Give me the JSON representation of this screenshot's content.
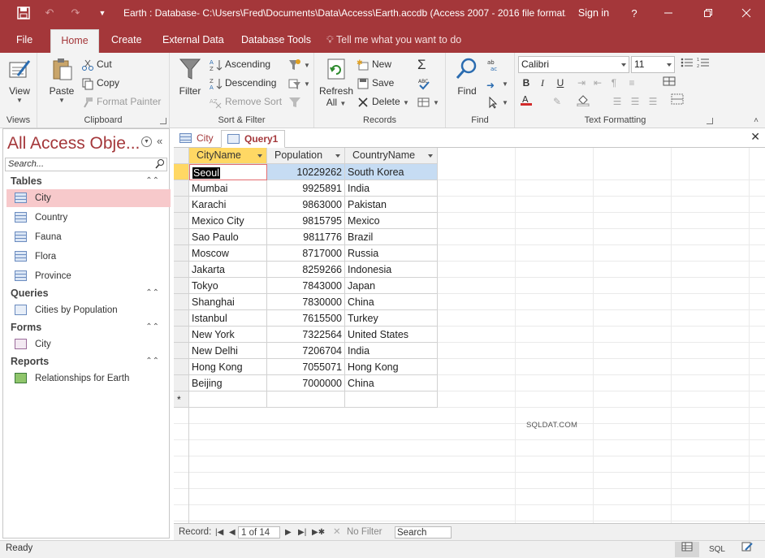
{
  "window": {
    "title": "Earth : Database- C:\\Users\\Fred\\Documents\\Data\\Access\\Earth.accdb (Access 2007 - 2016 file format...",
    "sign_in": "Sign in",
    "help": "?"
  },
  "ribbon_tabs": [
    {
      "label": "File"
    },
    {
      "label": "Home"
    },
    {
      "label": "Create"
    },
    {
      "label": "External Data"
    },
    {
      "label": "Database Tools"
    }
  ],
  "tell_me": "Tell me what you want to do",
  "ribbon": {
    "views": {
      "label": "Views",
      "view": "View"
    },
    "clipboard": {
      "label": "Clipboard",
      "paste": "Paste",
      "cut": "Cut",
      "copy": "Copy",
      "format_painter": "Format Painter"
    },
    "sort_filter": {
      "label": "Sort & Filter",
      "filter": "Filter",
      "ascending": "Ascending",
      "descending": "Descending",
      "remove_sort": "Remove Sort"
    },
    "records": {
      "label": "Records",
      "refresh": "Refresh",
      "refresh_all": "All",
      "new": "New",
      "save": "Save",
      "delete": "Delete"
    },
    "find": {
      "label": "Find",
      "find": "Find"
    },
    "text_formatting": {
      "label": "Text Formatting",
      "font": "Calibri",
      "size": "11",
      "bold": "B",
      "italic": "I",
      "underline": "U"
    }
  },
  "nav_pane": {
    "title": "All Access Obje...",
    "search_placeholder": "Search...",
    "groups": [
      {
        "label": "Tables",
        "items": [
          "City",
          "Country",
          "Fauna",
          "Flora",
          "Province"
        ]
      },
      {
        "label": "Queries",
        "items": [
          "Cities by Population"
        ]
      },
      {
        "label": "Forms",
        "items": [
          "City"
        ]
      },
      {
        "label": "Reports",
        "items": [
          "Relationships for Earth"
        ]
      }
    ]
  },
  "doc_tabs": [
    {
      "label": "City"
    },
    {
      "label": "Query1"
    }
  ],
  "datasheet": {
    "columns": [
      "CityName",
      "Population",
      "CountryName"
    ],
    "rows": [
      [
        "Seoul",
        "10229262",
        "South Korea"
      ],
      [
        "Mumbai",
        "9925891",
        "India"
      ],
      [
        "Karachi",
        "9863000",
        "Pakistan"
      ],
      [
        "Mexico City",
        "9815795",
        "Mexico"
      ],
      [
        "Sao Paulo",
        "9811776",
        "Brazil"
      ],
      [
        "Moscow",
        "8717000",
        "Russia"
      ],
      [
        "Jakarta",
        "8259266",
        "Indonesia"
      ],
      [
        "Tokyo",
        "7843000",
        "Japan"
      ],
      [
        "Shanghai",
        "7830000",
        "China"
      ],
      [
        "Istanbul",
        "7615500",
        "Turkey"
      ],
      [
        "New York",
        "7322564",
        "United States"
      ],
      [
        "New Delhi",
        "7206704",
        "India"
      ],
      [
        "Hong Kong",
        "7055071",
        "Hong Kong"
      ],
      [
        "Beijing",
        "7000000",
        "China"
      ]
    ],
    "new_row_marker": "*",
    "watermark": "SQLDAT.COM"
  },
  "record_nav": {
    "label": "Record:",
    "position": "1 of 14",
    "no_filter": "No Filter",
    "search": "Search"
  },
  "status": {
    "text": "Ready",
    "sql_view": "SQL"
  },
  "colors": {
    "accent": "#a4373a",
    "selected_row": "#c6dcf3",
    "current_header": "#ffd864"
  }
}
